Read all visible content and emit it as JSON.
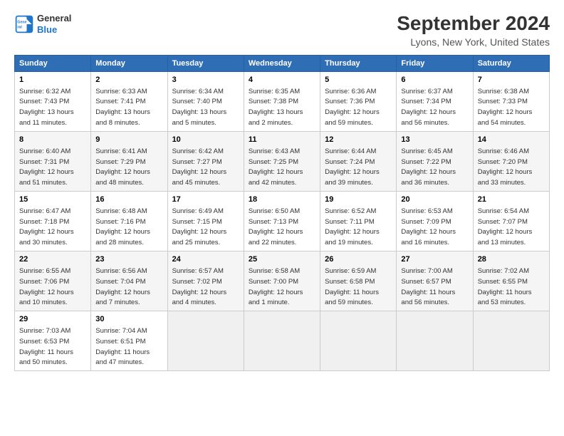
{
  "header": {
    "logo_line1": "General",
    "logo_line2": "Blue",
    "title": "September 2024",
    "subtitle": "Lyons, New York, United States"
  },
  "columns": [
    "Sunday",
    "Monday",
    "Tuesday",
    "Wednesday",
    "Thursday",
    "Friday",
    "Saturday"
  ],
  "weeks": [
    [
      {
        "day": "1",
        "sunrise": "Sunrise: 6:32 AM",
        "sunset": "Sunset: 7:43 PM",
        "daylight": "Daylight: 13 hours and 11 minutes."
      },
      {
        "day": "2",
        "sunrise": "Sunrise: 6:33 AM",
        "sunset": "Sunset: 7:41 PM",
        "daylight": "Daylight: 13 hours and 8 minutes."
      },
      {
        "day": "3",
        "sunrise": "Sunrise: 6:34 AM",
        "sunset": "Sunset: 7:40 PM",
        "daylight": "Daylight: 13 hours and 5 minutes."
      },
      {
        "day": "4",
        "sunrise": "Sunrise: 6:35 AM",
        "sunset": "Sunset: 7:38 PM",
        "daylight": "Daylight: 13 hours and 2 minutes."
      },
      {
        "day": "5",
        "sunrise": "Sunrise: 6:36 AM",
        "sunset": "Sunset: 7:36 PM",
        "daylight": "Daylight: 12 hours and 59 minutes."
      },
      {
        "day": "6",
        "sunrise": "Sunrise: 6:37 AM",
        "sunset": "Sunset: 7:34 PM",
        "daylight": "Daylight: 12 hours and 56 minutes."
      },
      {
        "day": "7",
        "sunrise": "Sunrise: 6:38 AM",
        "sunset": "Sunset: 7:33 PM",
        "daylight": "Daylight: 12 hours and 54 minutes."
      }
    ],
    [
      {
        "day": "8",
        "sunrise": "Sunrise: 6:40 AM",
        "sunset": "Sunset: 7:31 PM",
        "daylight": "Daylight: 12 hours and 51 minutes."
      },
      {
        "day": "9",
        "sunrise": "Sunrise: 6:41 AM",
        "sunset": "Sunset: 7:29 PM",
        "daylight": "Daylight: 12 hours and 48 minutes."
      },
      {
        "day": "10",
        "sunrise": "Sunrise: 6:42 AM",
        "sunset": "Sunset: 7:27 PM",
        "daylight": "Daylight: 12 hours and 45 minutes."
      },
      {
        "day": "11",
        "sunrise": "Sunrise: 6:43 AM",
        "sunset": "Sunset: 7:25 PM",
        "daylight": "Daylight: 12 hours and 42 minutes."
      },
      {
        "day": "12",
        "sunrise": "Sunrise: 6:44 AM",
        "sunset": "Sunset: 7:24 PM",
        "daylight": "Daylight: 12 hours and 39 minutes."
      },
      {
        "day": "13",
        "sunrise": "Sunrise: 6:45 AM",
        "sunset": "Sunset: 7:22 PM",
        "daylight": "Daylight: 12 hours and 36 minutes."
      },
      {
        "day": "14",
        "sunrise": "Sunrise: 6:46 AM",
        "sunset": "Sunset: 7:20 PM",
        "daylight": "Daylight: 12 hours and 33 minutes."
      }
    ],
    [
      {
        "day": "15",
        "sunrise": "Sunrise: 6:47 AM",
        "sunset": "Sunset: 7:18 PM",
        "daylight": "Daylight: 12 hours and 30 minutes."
      },
      {
        "day": "16",
        "sunrise": "Sunrise: 6:48 AM",
        "sunset": "Sunset: 7:16 PM",
        "daylight": "Daylight: 12 hours and 28 minutes."
      },
      {
        "day": "17",
        "sunrise": "Sunrise: 6:49 AM",
        "sunset": "Sunset: 7:15 PM",
        "daylight": "Daylight: 12 hours and 25 minutes."
      },
      {
        "day": "18",
        "sunrise": "Sunrise: 6:50 AM",
        "sunset": "Sunset: 7:13 PM",
        "daylight": "Daylight: 12 hours and 22 minutes."
      },
      {
        "day": "19",
        "sunrise": "Sunrise: 6:52 AM",
        "sunset": "Sunset: 7:11 PM",
        "daylight": "Daylight: 12 hours and 19 minutes."
      },
      {
        "day": "20",
        "sunrise": "Sunrise: 6:53 AM",
        "sunset": "Sunset: 7:09 PM",
        "daylight": "Daylight: 12 hours and 16 minutes."
      },
      {
        "day": "21",
        "sunrise": "Sunrise: 6:54 AM",
        "sunset": "Sunset: 7:07 PM",
        "daylight": "Daylight: 12 hours and 13 minutes."
      }
    ],
    [
      {
        "day": "22",
        "sunrise": "Sunrise: 6:55 AM",
        "sunset": "Sunset: 7:06 PM",
        "daylight": "Daylight: 12 hours and 10 minutes."
      },
      {
        "day": "23",
        "sunrise": "Sunrise: 6:56 AM",
        "sunset": "Sunset: 7:04 PM",
        "daylight": "Daylight: 12 hours and 7 minutes."
      },
      {
        "day": "24",
        "sunrise": "Sunrise: 6:57 AM",
        "sunset": "Sunset: 7:02 PM",
        "daylight": "Daylight: 12 hours and 4 minutes."
      },
      {
        "day": "25",
        "sunrise": "Sunrise: 6:58 AM",
        "sunset": "Sunset: 7:00 PM",
        "daylight": "Daylight: 12 hours and 1 minute."
      },
      {
        "day": "26",
        "sunrise": "Sunrise: 6:59 AM",
        "sunset": "Sunset: 6:58 PM",
        "daylight": "Daylight: 11 hours and 59 minutes."
      },
      {
        "day": "27",
        "sunrise": "Sunrise: 7:00 AM",
        "sunset": "Sunset: 6:57 PM",
        "daylight": "Daylight: 11 hours and 56 minutes."
      },
      {
        "day": "28",
        "sunrise": "Sunrise: 7:02 AM",
        "sunset": "Sunset: 6:55 PM",
        "daylight": "Daylight: 11 hours and 53 minutes."
      }
    ],
    [
      {
        "day": "29",
        "sunrise": "Sunrise: 7:03 AM",
        "sunset": "Sunset: 6:53 PM",
        "daylight": "Daylight: 11 hours and 50 minutes."
      },
      {
        "day": "30",
        "sunrise": "Sunrise: 7:04 AM",
        "sunset": "Sunset: 6:51 PM",
        "daylight": "Daylight: 11 hours and 47 minutes."
      },
      null,
      null,
      null,
      null,
      null
    ]
  ]
}
